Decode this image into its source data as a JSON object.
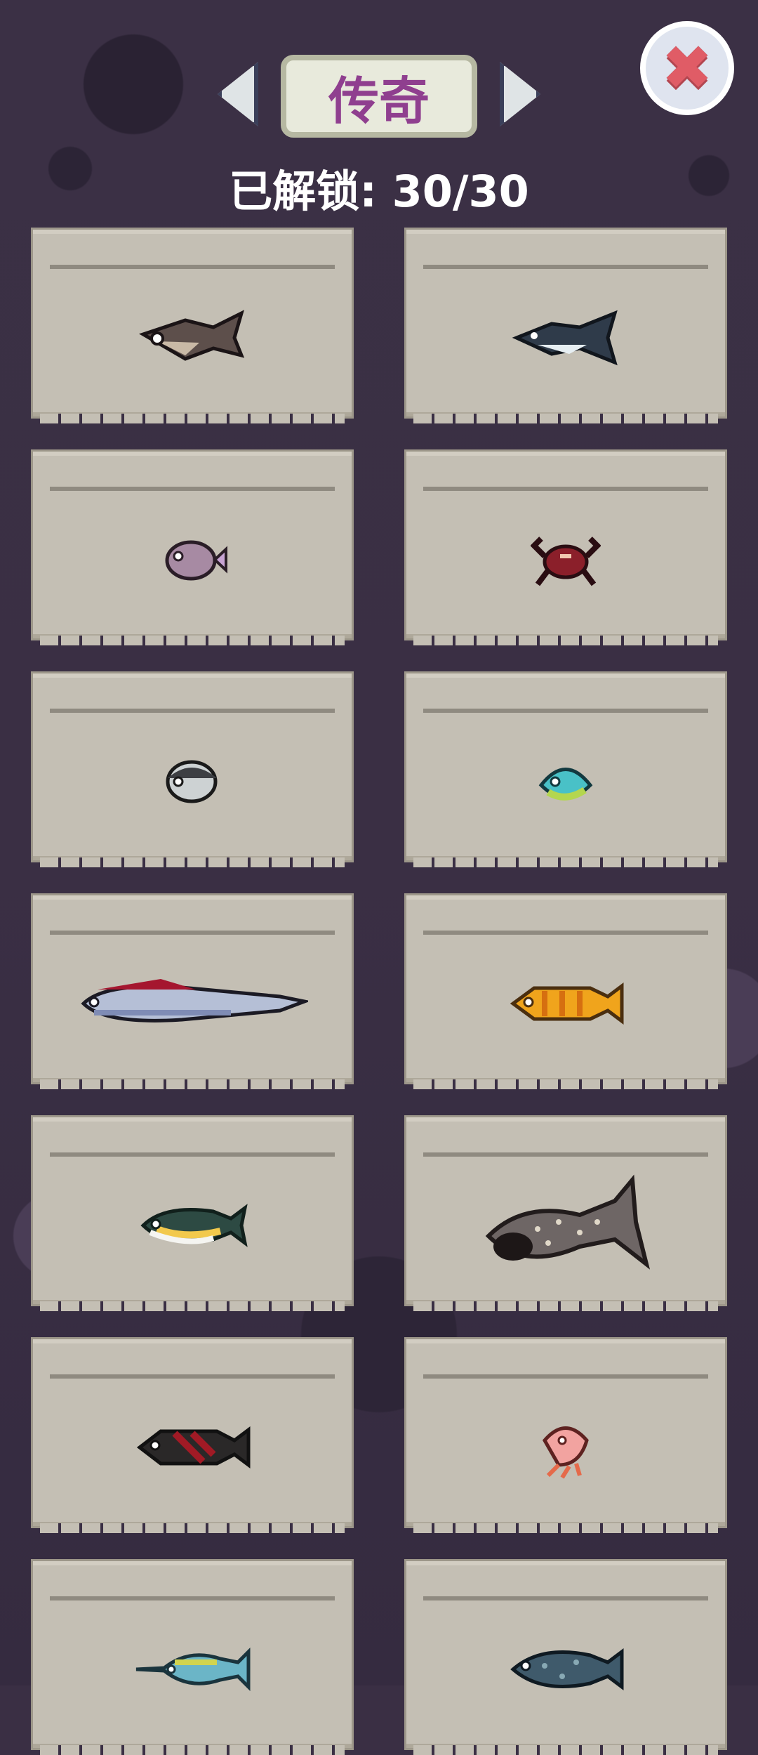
{
  "header": {
    "category_label": "传奇",
    "unlock_text": "已解锁: 30/30"
  },
  "icons": {
    "prev": "chevron-left-icon",
    "next": "chevron-right-icon",
    "close": "close-icon"
  },
  "colors": {
    "background": "#3a2f44",
    "card": "#c4bfb4",
    "category_text": "#8f3f8f",
    "close_x": "#e05c66"
  },
  "fish_cards": [
    {
      "icon": "hammerhead-shark-icon"
    },
    {
      "icon": "shark-icon"
    },
    {
      "icon": "purple-pufferfish-icon"
    },
    {
      "icon": "red-crab-icon"
    },
    {
      "icon": "white-blowfish-icon"
    },
    {
      "icon": "teal-fish-icon"
    },
    {
      "icon": "oarfish-icon"
    },
    {
      "icon": "orange-koi-icon"
    },
    {
      "icon": "yellowtail-icon"
    },
    {
      "icon": "whale-shark-icon"
    },
    {
      "icon": "black-koi-icon"
    },
    {
      "icon": "pink-shrimp-icon"
    },
    {
      "icon": "swordfish-icon"
    },
    {
      "icon": "coelacanth-icon"
    }
  ]
}
